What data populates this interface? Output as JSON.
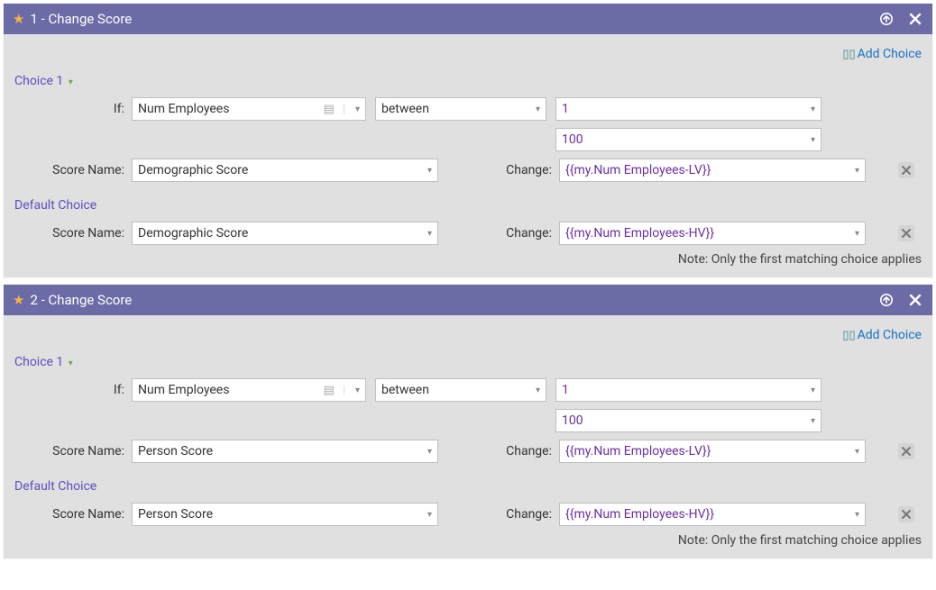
{
  "panels": [
    {
      "title": "1 - Change Score",
      "add_choice_label": "Add Choice",
      "choice_label": "Choice 1",
      "if_label": "If:",
      "score_name_label": "Score Name:",
      "change_label": "Change:",
      "default_choice_label": "Default Choice",
      "note": "Note: Only the first matching choice applies",
      "choice": {
        "attribute": "Num Employees",
        "operator": "between",
        "value_from": "1",
        "value_to": "100",
        "score_name": "Demographic Score",
        "change": "{{my.Num Employees-LV}}"
      },
      "default": {
        "score_name": "Demographic Score",
        "change": "{{my.Num Employees-HV}}"
      }
    },
    {
      "title": "2 - Change Score",
      "add_choice_label": "Add Choice",
      "choice_label": "Choice 1",
      "if_label": "If:",
      "score_name_label": "Score Name:",
      "change_label": "Change:",
      "default_choice_label": "Default Choice",
      "note": "Note: Only the first matching choice applies",
      "choice": {
        "attribute": "Num Employees",
        "operator": "between",
        "value_from": "1",
        "value_to": "100",
        "score_name": "Person Score",
        "change": "{{my.Num Employees-LV}}"
      },
      "default": {
        "score_name": "Person Score",
        "change": "{{my.Num Employees-HV}}"
      }
    }
  ]
}
